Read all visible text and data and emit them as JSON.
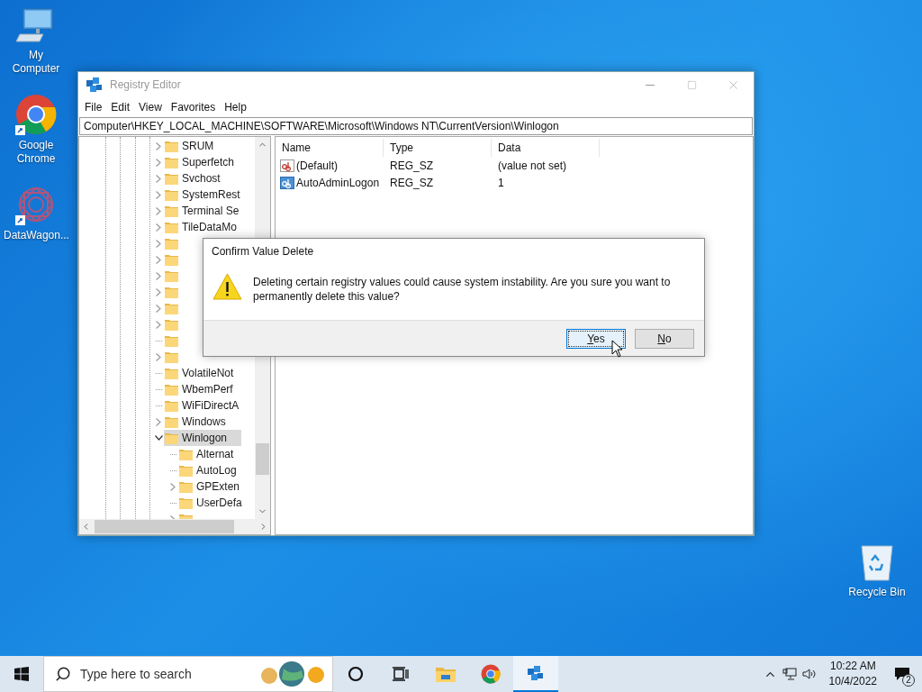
{
  "desktop_icons": [
    {
      "label": "My Computer",
      "kind": "computer",
      "shortcut": false
    },
    {
      "label": "Google Chrome",
      "kind": "chrome",
      "shortcut": true
    },
    {
      "label": "DataWagon...",
      "kind": "app",
      "shortcut": true
    },
    {
      "label": "Recycle Bin",
      "kind": "recycle",
      "shortcut": false
    }
  ],
  "window": {
    "title": "Registry Editor",
    "menu": [
      "File",
      "Edit",
      "View",
      "Favorites",
      "Help"
    ],
    "address": "Computer\\HKEY_LOCAL_MACHINE\\SOFTWARE\\Microsoft\\Windows NT\\CurrentVersion\\Winlogon",
    "tree": [
      {
        "label": "SRUM",
        "expandable": true,
        "expanded": false,
        "selected": false
      },
      {
        "label": "Superfetch",
        "expandable": true,
        "expanded": false,
        "selected": false
      },
      {
        "label": "Svchost",
        "expandable": true,
        "expanded": false,
        "selected": false
      },
      {
        "label": "SystemRest",
        "expandable": true,
        "expanded": false,
        "selected": false
      },
      {
        "label": "Terminal Se",
        "expandable": true,
        "expanded": false,
        "selected": false
      },
      {
        "label": "TileDataMo",
        "expandable": true,
        "expanded": false,
        "selected": false
      },
      {
        "expandable": true,
        "expanded": false,
        "selected": false
      },
      {
        "expandable": true,
        "expanded": false,
        "selected": false
      },
      {
        "expandable": true,
        "expanded": false,
        "selected": false
      },
      {
        "expandable": true,
        "expanded": false,
        "selected": false
      },
      {
        "expandable": true,
        "expanded": false,
        "selected": false
      },
      {
        "expandable": true,
        "expanded": false,
        "selected": false
      },
      {
        "expandable": false,
        "selected": false
      },
      {
        "expandable": true,
        "expanded": false,
        "selected": false
      },
      {
        "label": "VolatileNot",
        "expandable": false,
        "selected": false
      },
      {
        "label": "WbemPerf",
        "expandable": false,
        "selected": false
      },
      {
        "label": "WiFiDirectA",
        "expandable": false,
        "selected": false
      },
      {
        "label": "Windows",
        "expandable": true,
        "expanded": false,
        "selected": false
      },
      {
        "label": "Winlogon",
        "expandable": true,
        "expanded": true,
        "selected": true,
        "children": [
          {
            "label": "Alternat",
            "expandable": false,
            "selected": false
          },
          {
            "label": "AutoLog",
            "expandable": false,
            "selected": false
          },
          {
            "label": "GPExten",
            "expandable": true,
            "expanded": false,
            "selected": false
          },
          {
            "label": "UserDefa",
            "expandable": false,
            "selected": false
          },
          {
            "expandable": true,
            "expanded": false,
            "selected": false
          }
        ]
      }
    ],
    "columns": [
      "Name",
      "Type",
      "Data"
    ],
    "values": [
      {
        "name": "(Default)",
        "type": "REG_SZ",
        "data": "(value not set)",
        "selected": false
      },
      {
        "name": "AutoAdminLogon",
        "type": "REG_SZ",
        "data": "1",
        "selected": true
      }
    ]
  },
  "dialog": {
    "title": "Confirm Value Delete",
    "message": "Deleting certain registry values could cause system instability. Are you sure you want to permanently delete this value?",
    "buttons": [
      {
        "label": "Yes",
        "focused": true
      },
      {
        "label": "No",
        "focused": false
      }
    ]
  },
  "taskbar": {
    "search_placeholder": "Type here to search",
    "apps": [
      {
        "kind": "cortana",
        "active": false
      },
      {
        "kind": "taskview",
        "active": false
      },
      {
        "kind": "explorer",
        "active": false
      },
      {
        "kind": "chrome",
        "active": false
      },
      {
        "kind": "regedit",
        "active": true
      }
    ],
    "time": "10:22 AM",
    "date": "10/4/2022",
    "notifications": "2"
  }
}
